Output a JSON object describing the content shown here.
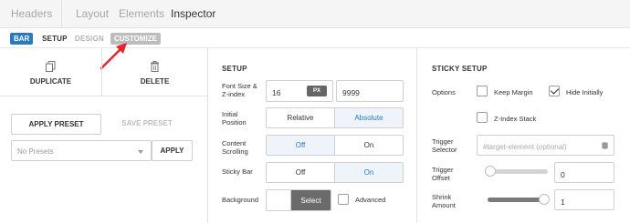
{
  "topnav": {
    "headers": "Headers",
    "layout": "Layout",
    "elements": "Elements",
    "inspector": "Inspector"
  },
  "subnav": {
    "badge": "BAR",
    "setup": "SETUP",
    "design": "DESIGN",
    "customize": "CUSTOMIZE"
  },
  "left": {
    "duplicate": "DUPLICATE",
    "delete": "DELETE",
    "apply_preset": "APPLY PRESET",
    "save_preset": "SAVE PRESET",
    "presets_placeholder": "No Presets",
    "apply": "APPLY"
  },
  "setup": {
    "heading": "SETUP",
    "font_label": "Font Size & Z-index",
    "font_size": "16",
    "unit": "PX",
    "z_index": "9999",
    "initial_label": "Initial Position",
    "relative": "Relative",
    "absolute": "Absolute",
    "content_label": "Content Scrolling",
    "off": "Off",
    "on": "On",
    "sticky_label": "Sticky Bar",
    "background_label": "Background",
    "select": "Select",
    "advanced": "Advanced"
  },
  "sticky": {
    "heading": "STICKY SETUP",
    "options_label": "Options",
    "keep_margin": "Keep Margin",
    "hide_initially": "Hide Initially",
    "zindex_stack": "Z-Index Stack",
    "trigger_selector_label": "Trigger Selector",
    "trigger_placeholder": "#target-element (optional)",
    "trigger_offset_label": "Trigger Offset",
    "trigger_offset": "0",
    "trigger_offset_level": 0,
    "shrink_label": "Shrink Amount",
    "shrink": "1",
    "shrink_level": 1
  },
  "colors": {
    "accent": "#2b79c2",
    "arrow": "#e3262b"
  }
}
